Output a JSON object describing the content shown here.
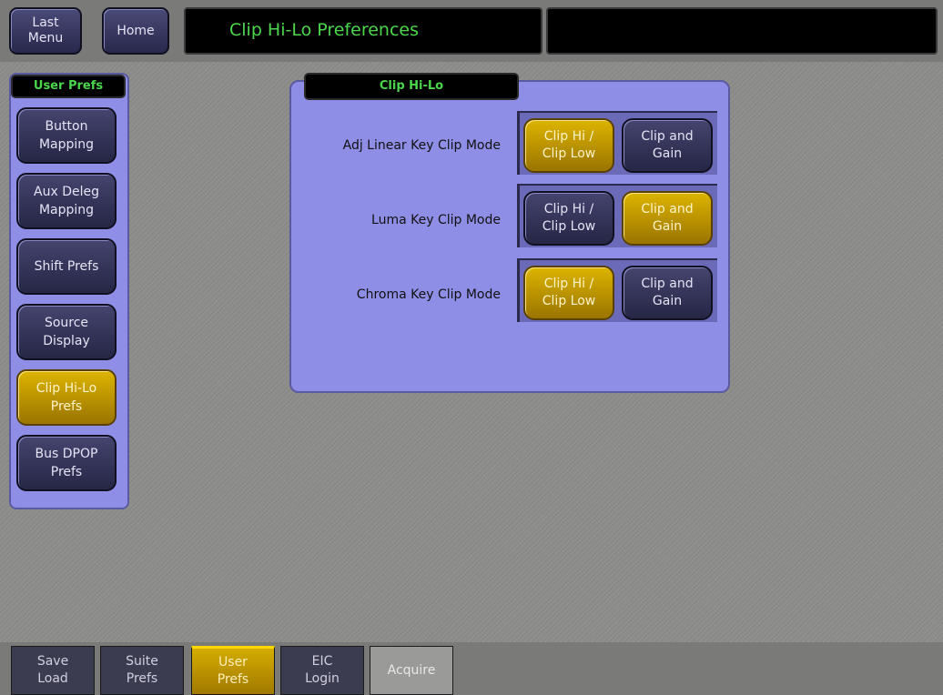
{
  "header": {
    "last_menu_label": "Last\nMenu",
    "home_label": "Home",
    "title": "Clip Hi-Lo Preferences",
    "status_text": ""
  },
  "sidebar": {
    "title": "User Prefs",
    "items": [
      {
        "label": "Button\nMapping",
        "active": false
      },
      {
        "label": "Aux Deleg\nMapping",
        "active": false
      },
      {
        "label": "Shift Prefs",
        "active": false
      },
      {
        "label": "Source\nDisplay",
        "active": false
      },
      {
        "label": "Clip Hi-Lo\nPrefs",
        "active": true
      },
      {
        "label": "Bus DPOP\nPrefs",
        "active": false
      }
    ]
  },
  "panel": {
    "title": "Clip Hi-Lo",
    "rows": [
      {
        "label": "Adj Linear Key Clip Mode",
        "option_a": "Clip Hi /\nClip Low",
        "option_b": "Clip and\nGain",
        "selected": "a"
      },
      {
        "label": "Luma Key Clip Mode",
        "option_a": "Clip Hi /\nClip Low",
        "option_b": "Clip and\nGain",
        "selected": "b"
      },
      {
        "label": "Chroma Key Clip Mode",
        "option_a": "Clip Hi /\nClip Low",
        "option_b": "Clip and\nGain",
        "selected": "a"
      }
    ]
  },
  "tabs": [
    {
      "label": "Save\nLoad",
      "state": "normal"
    },
    {
      "label": "Suite\nPrefs",
      "state": "normal"
    },
    {
      "label": "User\nPrefs",
      "state": "active"
    },
    {
      "label": "EIC\nLogin",
      "state": "normal"
    },
    {
      "label": "Acquire",
      "state": "disabled"
    }
  ],
  "colors": {
    "accent_active": "#dcb400",
    "panel_bg": "#8e8ee6",
    "title_text": "#4cd64c"
  }
}
